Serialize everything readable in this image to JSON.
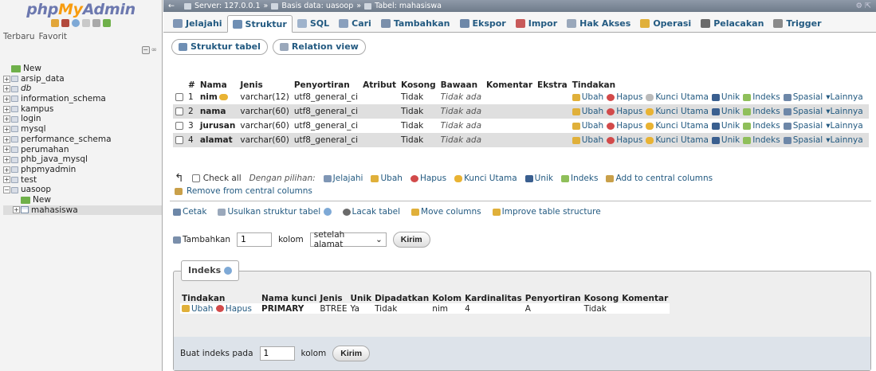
{
  "nav": {
    "logo": {
      "php": "php",
      "my": "My",
      "admin": "Admin"
    },
    "tab_recent": "Terbaru",
    "tab_favorite": "Favorit",
    "tree": [
      {
        "label": "New",
        "kind": "new"
      },
      {
        "label": "arsip_data",
        "kind": "db"
      },
      {
        "label": "db",
        "kind": "db-italic"
      },
      {
        "label": "information_schema",
        "kind": "db"
      },
      {
        "label": "kampus",
        "kind": "db"
      },
      {
        "label": "login",
        "kind": "db"
      },
      {
        "label": "mysql",
        "kind": "db"
      },
      {
        "label": "performance_schema",
        "kind": "db"
      },
      {
        "label": "perumahan",
        "kind": "db"
      },
      {
        "label": "phb_java_mysql",
        "kind": "db"
      },
      {
        "label": "phpmyadmin",
        "kind": "db"
      },
      {
        "label": "test",
        "kind": "db"
      },
      {
        "label": "uasoop",
        "kind": "db-open"
      },
      {
        "label": "New",
        "kind": "child-new"
      },
      {
        "label": "mahasiswa",
        "kind": "child-table"
      }
    ]
  },
  "breadcrumb": {
    "server": "Server: 127.0.0.1",
    "database": "Basis data: uasoop",
    "table": "Tabel: mahasiswa",
    "sep": "»"
  },
  "menu": [
    {
      "label": "Jelajahi",
      "icon": "browse-icon",
      "color": "#7f96b5"
    },
    {
      "label": "Struktur",
      "icon": "structure-icon",
      "color": "#6f8fb4",
      "active": true
    },
    {
      "label": "SQL",
      "icon": "sql-icon",
      "color": "#9fb3cc"
    },
    {
      "label": "Cari",
      "icon": "search-icon",
      "color": "#8aa0bd"
    },
    {
      "label": "Tambahkan",
      "icon": "insert-icon",
      "color": "#7a8fab"
    },
    {
      "label": "Ekspor",
      "icon": "export-icon",
      "color": "#6d87a8"
    },
    {
      "label": "Impor",
      "icon": "import-icon",
      "color": "#c85a5a"
    },
    {
      "label": "Hak Akses",
      "icon": "privileges-icon",
      "color": "#9aa8bb"
    },
    {
      "label": "Operasi",
      "icon": "operations-icon",
      "color": "#e0b03a"
    },
    {
      "label": "Pelacakan",
      "icon": "tracking-icon",
      "color": "#6a6a6a"
    },
    {
      "label": "Trigger",
      "icon": "trigger-icon",
      "color": "#8a8a8a"
    }
  ],
  "subtabs": {
    "structure": "Struktur tabel",
    "relation": "Relation view"
  },
  "structure": {
    "headers": [
      "#",
      "Nama",
      "Jenis",
      "Penyortiran",
      "Atribut",
      "Kosong",
      "Bawaan",
      "Komentar",
      "Ekstra",
      "Tindakan"
    ],
    "rows": [
      {
        "no": "1",
        "name": "nim",
        "type": "varchar(12)",
        "collation": "utf8_general_ci",
        "attr": "",
        "null": "Tidak",
        "default": "Tidak ada",
        "comment": "",
        "extra": "",
        "primary": true
      },
      {
        "no": "2",
        "name": "nama",
        "type": "varchar(60)",
        "collation": "utf8_general_ci",
        "attr": "",
        "null": "Tidak",
        "default": "Tidak ada",
        "comment": "",
        "extra": "",
        "primary": false
      },
      {
        "no": "3",
        "name": "jurusan",
        "type": "varchar(60)",
        "collation": "utf8_general_ci",
        "attr": "",
        "null": "Tidak",
        "default": "Tidak ada",
        "comment": "",
        "extra": "",
        "primary": false
      },
      {
        "no": "4",
        "name": "alamat",
        "type": "varchar(60)",
        "collation": "utf8_general_ci",
        "attr": "",
        "null": "Tidak",
        "default": "Tidak ada",
        "comment": "",
        "extra": "",
        "primary": false
      }
    ],
    "actions": {
      "edit": "Ubah",
      "drop": "Hapus",
      "primary": "Kunci Utama",
      "unique": "Unik",
      "index": "Indeks",
      "spatial": "Spasial",
      "more": "Lainnya"
    }
  },
  "bulk": {
    "check_all": "Check all",
    "with_selected": "Dengan pilihan:",
    "browse": "Jelajahi",
    "edit": "Ubah",
    "drop": "Hapus",
    "primary": "Kunci Utama",
    "unique": "Unik",
    "index": "Indeks",
    "add_central": "Add to central columns",
    "remove_central": "Remove from central columns"
  },
  "links": {
    "print": "Cetak",
    "propose": "Usulkan struktur tabel",
    "track": "Lacak tabel",
    "move": "Move columns",
    "improve": "Improve table structure"
  },
  "add_columns": {
    "label": "Tambahkan",
    "count": "1",
    "unit": "kolom",
    "position": "setelah alamat",
    "submit": "Kirim"
  },
  "indexes": {
    "legend": "Indeks",
    "headers": [
      "Tindakan",
      "Nama kunci",
      "Jenis",
      "Unik",
      "Dipadatkan",
      "Kolom",
      "Kardinalitas",
      "Penyortiran",
      "Kosong",
      "Komentar"
    ],
    "row": {
      "edit": "Ubah",
      "drop": "Hapus",
      "key_name": "PRIMARY",
      "type": "BTREE",
      "unique": "Ya",
      "packed": "Tidak",
      "column": "nim",
      "cardinality": "4",
      "collation": "A",
      "null": "Tidak",
      "comment": ""
    },
    "create_label": "Buat indeks pada",
    "create_count": "1",
    "create_unit": "kolom",
    "create_submit": "Kirim"
  }
}
